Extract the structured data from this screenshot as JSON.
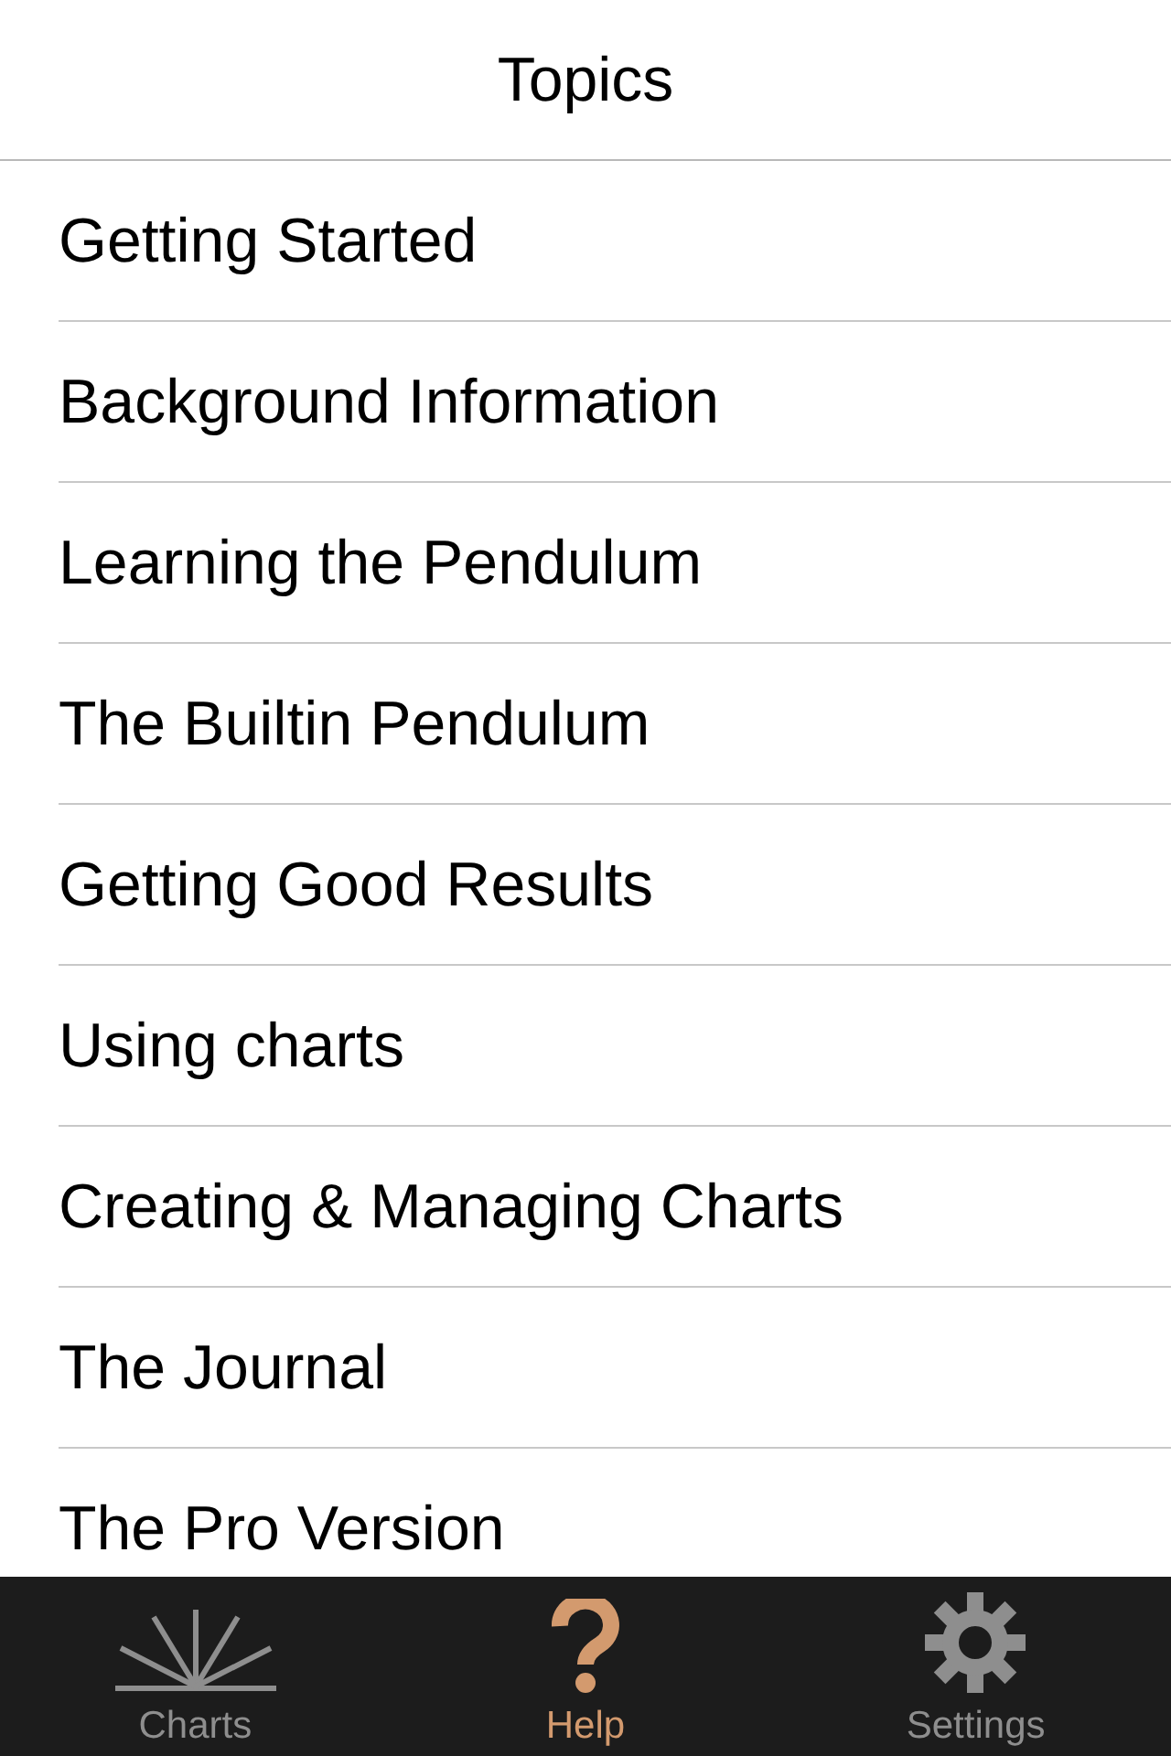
{
  "header": {
    "title": "Topics"
  },
  "topics": [
    "Getting Started",
    "Background Information",
    "Learning the Pendulum",
    "The Builtin Pendulum",
    "Getting Good Results",
    "Using charts",
    "Creating & Managing Charts",
    "The Journal",
    "The Pro Version"
  ],
  "tab_bar": [
    {
      "label": "Charts",
      "selected": false
    },
    {
      "label": "Help",
      "selected": true
    },
    {
      "label": "Settings",
      "selected": false
    }
  ]
}
